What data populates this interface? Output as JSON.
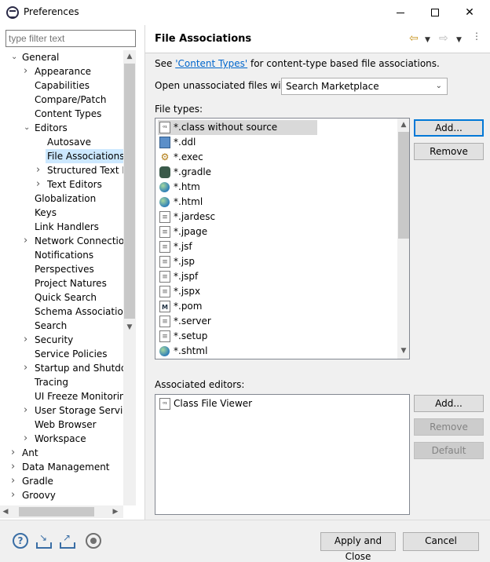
{
  "window": {
    "title": "Preferences",
    "min_glyph": "—",
    "max_glyph": "☐",
    "close_glyph": "✕"
  },
  "filter": {
    "placeholder": "type filter text"
  },
  "tree": [
    {
      "label": "General",
      "level": 0,
      "twisty": "open"
    },
    {
      "label": "Appearance",
      "level": 1,
      "twisty": "closed"
    },
    {
      "label": "Capabilities",
      "level": 1,
      "twisty": "none"
    },
    {
      "label": "Compare/Patch",
      "level": 1,
      "twisty": "none"
    },
    {
      "label": "Content Types",
      "level": 1,
      "twisty": "none"
    },
    {
      "label": "Editors",
      "level": 1,
      "twisty": "open"
    },
    {
      "label": "Autosave",
      "level": 2,
      "twisty": "none"
    },
    {
      "label": "File Associations",
      "level": 2,
      "twisty": "none",
      "selected": true
    },
    {
      "label": "Structured Text Ed",
      "level": 2,
      "twisty": "closed"
    },
    {
      "label": "Text Editors",
      "level": 2,
      "twisty": "closed"
    },
    {
      "label": "Globalization",
      "level": 1,
      "twisty": "none"
    },
    {
      "label": "Keys",
      "level": 1,
      "twisty": "none"
    },
    {
      "label": "Link Handlers",
      "level": 1,
      "twisty": "none"
    },
    {
      "label": "Network Connection",
      "level": 1,
      "twisty": "closed"
    },
    {
      "label": "Notifications",
      "level": 1,
      "twisty": "none"
    },
    {
      "label": "Perspectives",
      "level": 1,
      "twisty": "none"
    },
    {
      "label": "Project Natures",
      "level": 1,
      "twisty": "none"
    },
    {
      "label": "Quick Search",
      "level": 1,
      "twisty": "none"
    },
    {
      "label": "Schema Associations",
      "level": 1,
      "twisty": "none"
    },
    {
      "label": "Search",
      "level": 1,
      "twisty": "none"
    },
    {
      "label": "Security",
      "level": 1,
      "twisty": "closed"
    },
    {
      "label": "Service Policies",
      "level": 1,
      "twisty": "none"
    },
    {
      "label": "Startup and Shutdow",
      "level": 1,
      "twisty": "closed"
    },
    {
      "label": "Tracing",
      "level": 1,
      "twisty": "none"
    },
    {
      "label": "UI Freeze Monitoring",
      "level": 1,
      "twisty": "none"
    },
    {
      "label": "User Storage Service",
      "level": 1,
      "twisty": "closed"
    },
    {
      "label": "Web Browser",
      "level": 1,
      "twisty": "none"
    },
    {
      "label": "Workspace",
      "level": 1,
      "twisty": "closed"
    },
    {
      "label": "Ant",
      "level": 0,
      "twisty": "closed"
    },
    {
      "label": "Data Management",
      "level": 0,
      "twisty": "closed"
    },
    {
      "label": "Gradle",
      "level": 0,
      "twisty": "closed"
    },
    {
      "label": "Groovy",
      "level": 0,
      "twisty": "closed"
    }
  ],
  "page": {
    "title": "File Associations",
    "see_prefix": "See ",
    "see_link": "'Content Types'",
    "see_suffix": " for content-type based file associations.",
    "open_label": "Open unassociated files with:",
    "open_value": "Search Marketplace",
    "file_types_label": "File types:",
    "associated_label": "Associated editors:"
  },
  "file_types": [
    {
      "name": "*.class without source",
      "icon": "class",
      "selected": true
    },
    {
      "name": "*.ddl",
      "icon": "db"
    },
    {
      "name": "*.exec",
      "icon": "gear"
    },
    {
      "name": "*.gradle",
      "icon": "gradle"
    },
    {
      "name": "*.htm",
      "icon": "globe"
    },
    {
      "name": "*.html",
      "icon": "globe"
    },
    {
      "name": "*.jardesc",
      "icon": "doc"
    },
    {
      "name": "*.jpage",
      "icon": "doc"
    },
    {
      "name": "*.jsf",
      "icon": "doc"
    },
    {
      "name": "*.jsp",
      "icon": "doc"
    },
    {
      "name": "*.jspf",
      "icon": "doc"
    },
    {
      "name": "*.jspx",
      "icon": "doc"
    },
    {
      "name": "*.pom",
      "icon": "m"
    },
    {
      "name": "*.server",
      "icon": "doc"
    },
    {
      "name": "*.setup",
      "icon": "doc"
    },
    {
      "name": "*.shtml",
      "icon": "globe"
    }
  ],
  "associated_editors": [
    {
      "name": "Class File Viewer",
      "icon": "class"
    }
  ],
  "buttons": {
    "ft_add": "Add...",
    "ft_remove": "Remove",
    "ae_add": "Add...",
    "ae_remove": "Remove",
    "ae_default": "Default",
    "apply_close": "Apply and Close",
    "cancel": "Cancel"
  },
  "colors": {
    "selection": "#cce8ff",
    "link": "#0066cc",
    "focus": "#0078d7"
  }
}
